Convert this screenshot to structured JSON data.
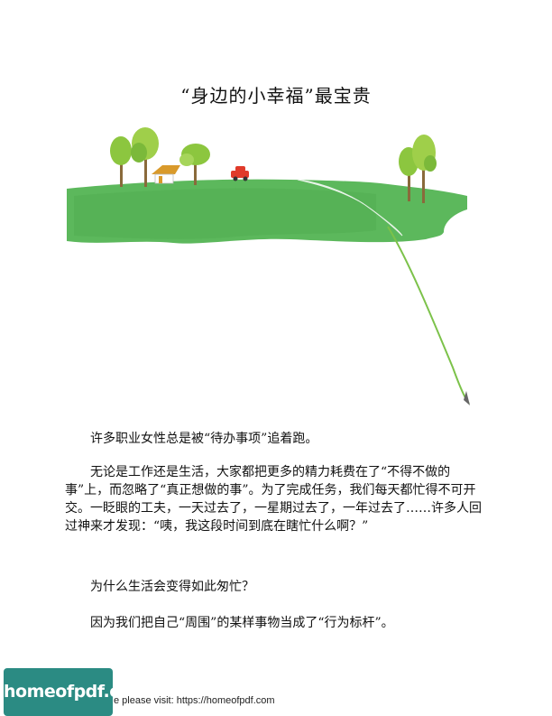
{
  "document": {
    "title": "“身边的小幸福”最宝贵",
    "paragraphs": [
      "许多职业女性总是被“待办事项”追着跑。",
      "无论是工作还是生活，大家都把更多的精力耗费在了“不得不做的事”上，而忽略了“真正想做的事”。为了完成任务，我们每天都忙得不可开交。一眨眼的工夫，一天过去了，一星期过去了，一年过去了……许多人回过神来才发现：“咦，我这段时间到底在瞎忙什么啊？”",
      "为什么生活会变得如此匆忙？",
      "因为我们把自己“周围”的某样事物当成了“行为标杆”。"
    ]
  },
  "footer": {
    "logo_text": "homeofpdf.com",
    "visit_text": "e please visit: https://homeofpdf.com"
  },
  "colors": {
    "grass": "#5cb85c",
    "grass_dark": "#4aa64a",
    "path": "#ffffff",
    "car": "#e03a2a",
    "house_roof": "#d99a2b",
    "tree_leaves": "#8cc63f",
    "tree_trunk": "#8a6a3b",
    "logo_bg": "#2b8b83"
  },
  "illustration": {
    "description_icons": [
      "tree-icon",
      "house-icon",
      "car-icon",
      "path-icon"
    ]
  }
}
